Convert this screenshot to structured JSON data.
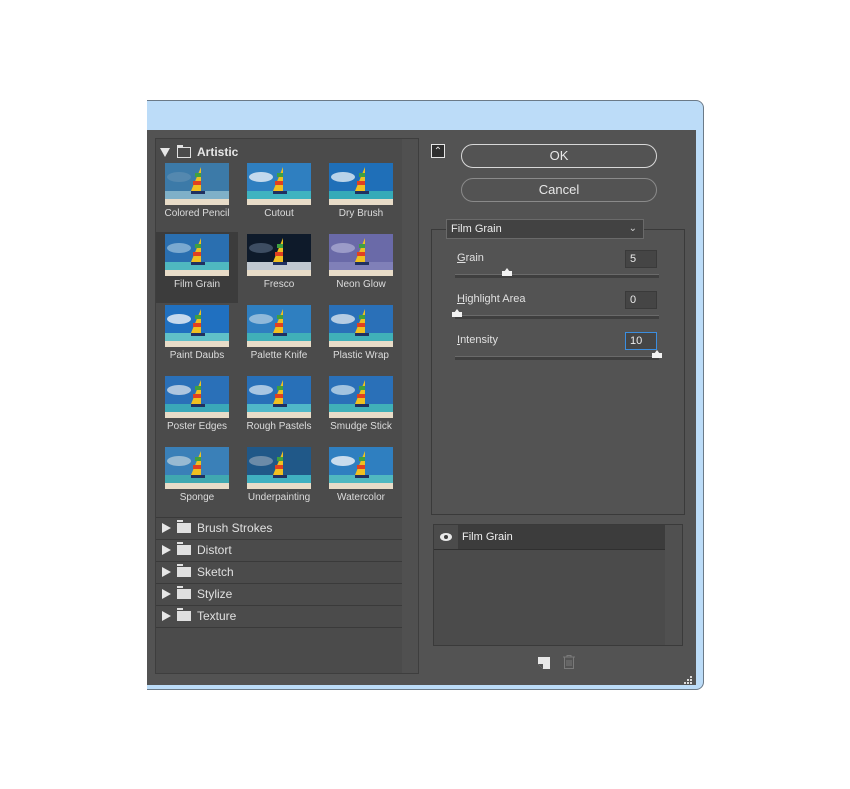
{
  "gallery": {
    "expanded_category": "Artistic",
    "filters": [
      {
        "label": "Colored Pencil"
      },
      {
        "label": "Cutout"
      },
      {
        "label": "Dry Brush"
      },
      {
        "label": "Film Grain",
        "selected": true
      },
      {
        "label": "Fresco"
      },
      {
        "label": "Neon Glow"
      },
      {
        "label": "Paint Daubs"
      },
      {
        "label": "Palette Knife"
      },
      {
        "label": "Plastic Wrap"
      },
      {
        "label": "Poster Edges"
      },
      {
        "label": "Rough Pastels"
      },
      {
        "label": "Smudge Stick"
      },
      {
        "label": "Sponge"
      },
      {
        "label": "Underpainting"
      },
      {
        "label": "Watercolor"
      }
    ],
    "collapsed_categories": [
      "Brush Strokes",
      "Distort",
      "Sketch",
      "Stylize",
      "Texture"
    ]
  },
  "buttons": {
    "ok": "OK",
    "cancel": "Cancel",
    "collapse_icon": "double-chevron-up-icon"
  },
  "settings": {
    "filter_select": "Film Grain",
    "params": [
      {
        "mnemonic": "G",
        "rest": "rain",
        "value": "5",
        "fraction": 0.25
      },
      {
        "mnemonic": "H",
        "rest": "ighlight Area",
        "value": "0",
        "fraction": 0.0
      },
      {
        "mnemonic": "I",
        "rest": "ntensity",
        "value": "10",
        "fraction": 1.0,
        "focused": true
      }
    ]
  },
  "layers": {
    "items": [
      {
        "name": "Film Grain",
        "visible": true
      }
    ],
    "new_layer_icon": "new-effect-layer-icon",
    "delete_icon": "trash-icon"
  },
  "colors": {
    "dialog_bg": "#535353",
    "title_bar": "#bcdcf8",
    "focus": "#3b8ee0"
  }
}
